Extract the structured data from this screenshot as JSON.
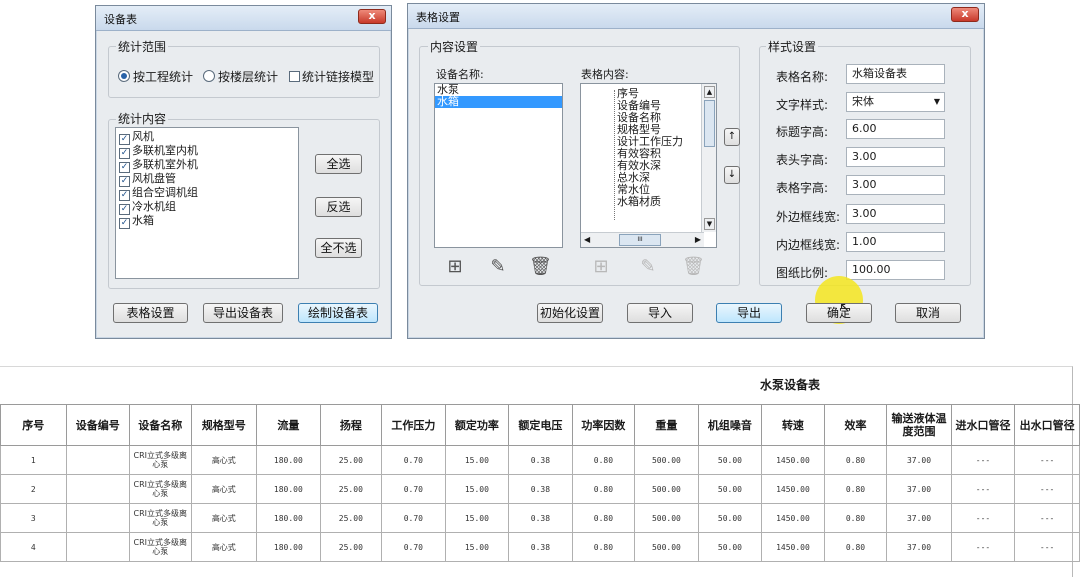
{
  "dialog1": {
    "title": "设备表",
    "close": "x",
    "scope_legend": "统计范围",
    "radio_project": "按工程统计",
    "radio_floor": "按楼层统计",
    "check_link": "统计链接模型",
    "content_legend": "统计内容",
    "items": [
      "风机",
      "多联机室内机",
      "多联机室外机",
      "风机盘管",
      "组合空调机组",
      "冷水机组",
      "水箱"
    ],
    "btn_select_all": "全选",
    "btn_invert": "反选",
    "btn_none": "全不选",
    "btn_table_settings": "表格设置",
    "btn_export": "导出设备表",
    "btn_draw": "绘制设备表"
  },
  "dialog2": {
    "title": "表格设置",
    "close": "x",
    "content_settings": "内容设置",
    "device_name_label": "设备名称:",
    "devices": [
      "水泵",
      "水箱"
    ],
    "table_content_label": "表格内容:",
    "table_content_items": [
      "序号",
      "设备编号",
      "设备名称",
      "规格型号",
      "设计工作压力",
      "有效容积",
      "有效水深",
      "总水深",
      "常水位",
      "水箱材质"
    ],
    "scroll_thumb": "III",
    "style_settings": "样式设置",
    "fields": [
      {
        "label": "表格名称:",
        "value": "水箱设备表"
      },
      {
        "label": "文字样式:",
        "value": "宋体"
      },
      {
        "label": "标题字高:",
        "value": "6.00"
      },
      {
        "label": "表头字高:",
        "value": "3.00"
      },
      {
        "label": "表格字高:",
        "value": "3.00"
      },
      {
        "label": "外边框线宽:",
        "value": "3.00"
      },
      {
        "label": "内边框线宽:",
        "value": "1.00"
      },
      {
        "label": "图纸比例:",
        "value": "100.00"
      }
    ],
    "btn_init": "初始化设置",
    "btn_import": "导入",
    "btn_export": "导出",
    "btn_ok": "确定",
    "btn_cancel": "取消"
  },
  "result_table": {
    "title": "水泵设备表",
    "headers": [
      "序号",
      "设备编号",
      "设备名称",
      "规格型号",
      "流量",
      "扬程",
      "工作压力",
      "额定功率",
      "额定电压",
      "功率因数",
      "重量",
      "机组噪音",
      "转速",
      "效率",
      "输送液体温度范围",
      "进水口管径",
      "出水口管径"
    ],
    "rows": [
      [
        "1",
        "",
        "CRI立式多级离心泵",
        "高心式",
        "180.00",
        "25.00",
        "0.70",
        "15.00",
        "0.38",
        "0.80",
        "500.00",
        "50.00",
        "1450.00",
        "0.80",
        "37.00",
        "---",
        "---"
      ],
      [
        "2",
        "",
        "CRI立式多级离心泵",
        "高心式",
        "180.00",
        "25.00",
        "0.70",
        "15.00",
        "0.38",
        "0.80",
        "500.00",
        "50.00",
        "1450.00",
        "0.80",
        "37.00",
        "---",
        "---"
      ],
      [
        "3",
        "",
        "CRI立式多级离心泵",
        "高心式",
        "180.00",
        "25.00",
        "0.70",
        "15.00",
        "0.38",
        "0.80",
        "500.00",
        "50.00",
        "1450.00",
        "0.80",
        "37.00",
        "---",
        "---"
      ],
      [
        "4",
        "",
        "CRI立式多级离心泵",
        "高心式",
        "180.00",
        "25.00",
        "0.70",
        "15.00",
        "0.38",
        "0.80",
        "500.00",
        "50.00",
        "1450.00",
        "0.80",
        "37.00",
        "---",
        "---"
      ]
    ]
  },
  "colors": {
    "highlight": "#3399ff",
    "cursor_halo": "#f5e61e"
  }
}
